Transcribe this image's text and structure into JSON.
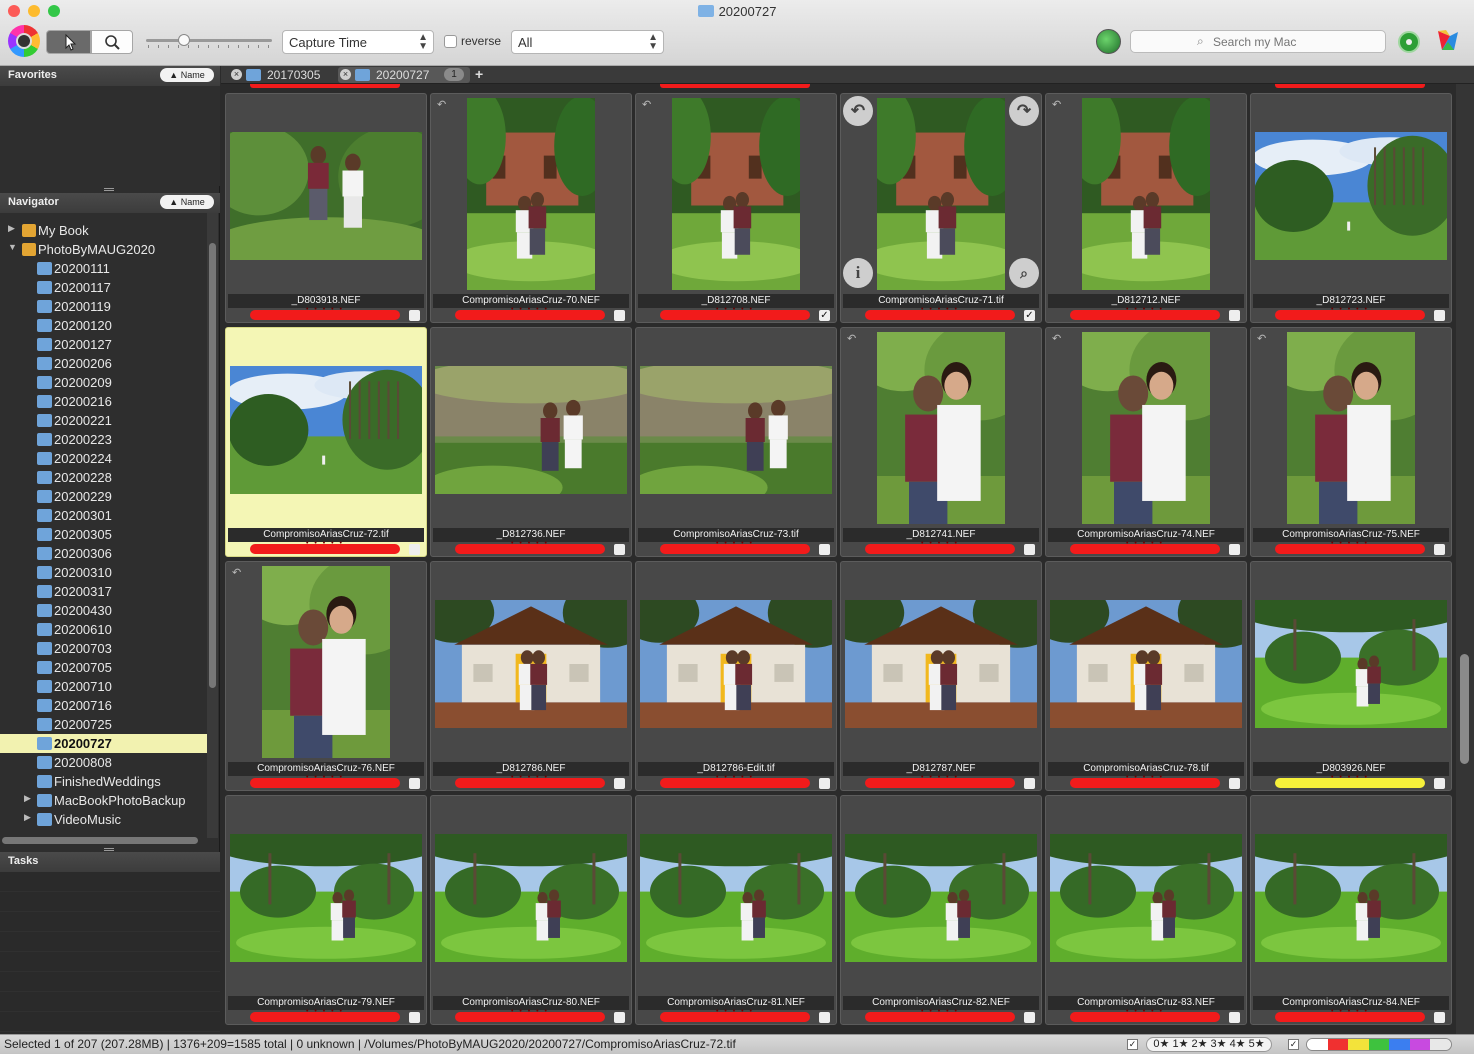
{
  "window": {
    "title": "20200727"
  },
  "toolbar": {
    "sort_select": "Capture Time",
    "reverse_label": "reverse",
    "filter_select": "All",
    "search_placeholder": "Search my Mac"
  },
  "favorites": {
    "title": "Favorites",
    "sort_label": "▲ Name"
  },
  "navigator": {
    "title": "Navigator",
    "sort_label": "▲ Name",
    "items": [
      {
        "label": "My Book",
        "type": "drive",
        "level": 0,
        "expand": "▶"
      },
      {
        "label": "PhotoByMAUG2020",
        "type": "drive",
        "level": 0,
        "expand": "▼"
      },
      {
        "label": "20200111",
        "type": "folder",
        "level": 1,
        "expand": ""
      },
      {
        "label": "20200117",
        "type": "folder",
        "level": 1,
        "expand": ""
      },
      {
        "label": "20200119",
        "type": "folder",
        "level": 1,
        "expand": ""
      },
      {
        "label": "20200120",
        "type": "folder",
        "level": 1,
        "expand": ""
      },
      {
        "label": "20200127",
        "type": "folder",
        "level": 1,
        "expand": ""
      },
      {
        "label": "20200206",
        "type": "folder",
        "level": 1,
        "expand": ""
      },
      {
        "label": "20200209",
        "type": "folder",
        "level": 1,
        "expand": ""
      },
      {
        "label": "20200216",
        "type": "folder",
        "level": 1,
        "expand": ""
      },
      {
        "label": "20200221",
        "type": "folder",
        "level": 1,
        "expand": ""
      },
      {
        "label": "20200223",
        "type": "folder",
        "level": 1,
        "expand": ""
      },
      {
        "label": "20200224",
        "type": "folder",
        "level": 1,
        "expand": ""
      },
      {
        "label": "20200228",
        "type": "folder",
        "level": 1,
        "expand": ""
      },
      {
        "label": "20200229",
        "type": "folder",
        "level": 1,
        "expand": ""
      },
      {
        "label": "20200301",
        "type": "folder",
        "level": 1,
        "expand": ""
      },
      {
        "label": "20200305",
        "type": "folder",
        "level": 1,
        "expand": ""
      },
      {
        "label": "20200306",
        "type": "folder",
        "level": 1,
        "expand": ""
      },
      {
        "label": "20200310",
        "type": "folder",
        "level": 1,
        "expand": ""
      },
      {
        "label": "20200317",
        "type": "folder",
        "level": 1,
        "expand": ""
      },
      {
        "label": "20200430",
        "type": "folder",
        "level": 1,
        "expand": ""
      },
      {
        "label": "20200610",
        "type": "folder",
        "level": 1,
        "expand": ""
      },
      {
        "label": "20200703",
        "type": "folder",
        "level": 1,
        "expand": ""
      },
      {
        "label": "20200705",
        "type": "folder",
        "level": 1,
        "expand": ""
      },
      {
        "label": "20200710",
        "type": "folder",
        "level": 1,
        "expand": ""
      },
      {
        "label": "20200716",
        "type": "folder",
        "level": 1,
        "expand": ""
      },
      {
        "label": "20200725",
        "type": "folder",
        "level": 1,
        "expand": ""
      },
      {
        "label": "20200727",
        "type": "folder",
        "level": 1,
        "expand": "",
        "selected": true
      },
      {
        "label": "20200808",
        "type": "folder",
        "level": 1,
        "expand": ""
      },
      {
        "label": "FinishedWeddings",
        "type": "folder",
        "level": 1,
        "expand": ""
      },
      {
        "label": "MacBookPhotoBackup",
        "type": "folder",
        "level": 1,
        "expand": "▶"
      },
      {
        "label": "VideoMusic",
        "type": "folder",
        "level": 1,
        "expand": "▶"
      }
    ]
  },
  "tasks": {
    "title": "Tasks"
  },
  "tabs": [
    {
      "label": "20170305",
      "active": false
    },
    {
      "label": "20200727",
      "active": true,
      "count": "1"
    }
  ],
  "grid": {
    "cells": [
      {
        "name": "_D803918.NEF",
        "orient": "land",
        "scene": "garden-couple",
        "checked": false
      },
      {
        "name": "CompromisoAriasCruz-70.NEF",
        "orient": "port",
        "scene": "house-garden",
        "checked": false,
        "rotate": true
      },
      {
        "name": "_D812708.NEF",
        "orient": "port",
        "scene": "house-garden",
        "checked": true,
        "rotate": true
      },
      {
        "name": "CompromisoAriasCruz-71.tif",
        "orient": "port",
        "scene": "house-garden",
        "checked": true,
        "overlay": true
      },
      {
        "name": "_D812712.NEF",
        "orient": "port",
        "scene": "house-garden",
        "checked": false,
        "rotate": true
      },
      {
        "name": "_D812723.NEF",
        "orient": "land",
        "scene": "field-sky",
        "checked": false
      },
      {
        "name": "CompromisoAriasCruz-72.tif",
        "orient": "land",
        "scene": "field-sky",
        "checked": false,
        "selected": true
      },
      {
        "name": "_D812736.NEF",
        "orient": "land",
        "scene": "wall-couple",
        "checked": false
      },
      {
        "name": "CompromisoAriasCruz-73.tif",
        "orient": "land",
        "scene": "wall-couple",
        "checked": false
      },
      {
        "name": "_D812741.NEF",
        "orient": "port",
        "scene": "portrait-couple",
        "checked": false,
        "rotate": true
      },
      {
        "name": "CompromisoAriasCruz-74.NEF",
        "orient": "port",
        "scene": "portrait-couple",
        "checked": false,
        "rotate": true
      },
      {
        "name": "CompromisoAriasCruz-75.NEF",
        "orient": "port",
        "scene": "portrait-couple",
        "checked": false,
        "rotate": true
      },
      {
        "name": "CompromisoAriasCruz-76.NEF",
        "orient": "port",
        "scene": "portrait-couple",
        "checked": false,
        "rotate": true
      },
      {
        "name": "_D812786.NEF",
        "orient": "land",
        "scene": "chapel",
        "checked": false
      },
      {
        "name": "_D812786-Edit.tif",
        "orient": "land",
        "scene": "chapel",
        "checked": false
      },
      {
        "name": "_D812787.NEF",
        "orient": "land",
        "scene": "chapel",
        "checked": false
      },
      {
        "name": "CompromisoAriasCruz-78.tif",
        "orient": "land",
        "scene": "chapel",
        "checked": false
      },
      {
        "name": "_D803926.NEF",
        "orient": "land",
        "scene": "tree-field",
        "checked": false,
        "yellow": true
      },
      {
        "name": "CompromisoAriasCruz-79.NEF",
        "orient": "land",
        "scene": "tree-field",
        "checked": false
      },
      {
        "name": "CompromisoAriasCruz-80.NEF",
        "orient": "land",
        "scene": "tree-field",
        "checked": false
      },
      {
        "name": "CompromisoAriasCruz-81.NEF",
        "orient": "land",
        "scene": "tree-field",
        "checked": false
      },
      {
        "name": "CompromisoAriasCruz-82.NEF",
        "orient": "land",
        "scene": "tree-field",
        "checked": false
      },
      {
        "name": "CompromisoAriasCruz-83.NEF",
        "orient": "land",
        "scene": "tree-field",
        "checked": false
      },
      {
        "name": "CompromisoAriasCruz-84.NEF",
        "orient": "land",
        "scene": "tree-field",
        "checked": false
      }
    ]
  },
  "status": {
    "text": "Selected 1 of 207 (207.28MB) | 1376+209=1585 total | 0 unknown | /Volumes/PhotoByMAUG2020/20200727/CompromisoAriasCruz-72.tif",
    "stars": "0★ 1★ 2★ 3★ 4★ 5★",
    "colors": [
      "#ffffff",
      "#f03030",
      "#f3e33a",
      "#3ec23e",
      "#3b7ef0",
      "#c84ae0",
      "#e8e8e8"
    ]
  }
}
